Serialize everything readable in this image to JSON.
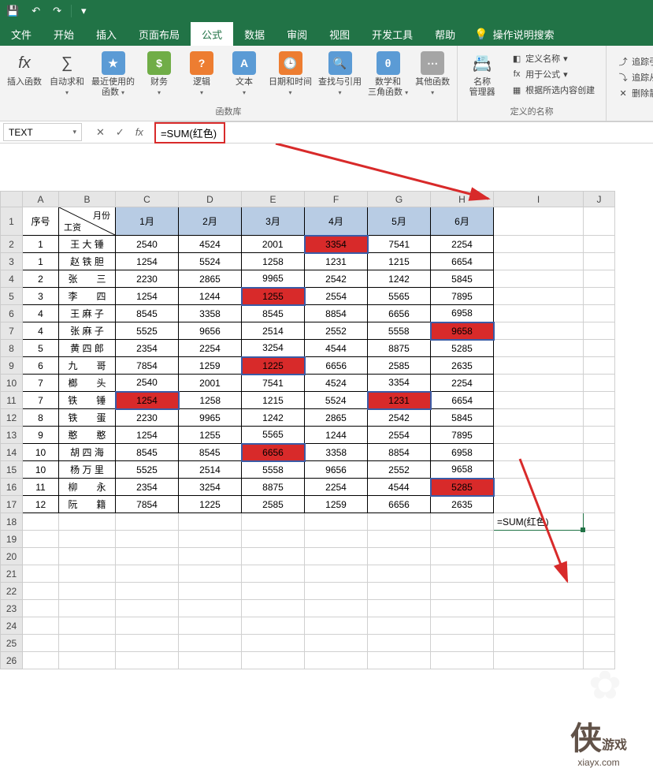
{
  "titlebar": {
    "save_icon": "💾",
    "undo_icon": "↶",
    "redo_icon": "↷"
  },
  "menu": {
    "tabs": [
      "文件",
      "开始",
      "插入",
      "页面布局",
      "公式",
      "数据",
      "审阅",
      "视图",
      "开发工具",
      "帮助"
    ],
    "active_index": 4,
    "search_hint": "操作说明搜索"
  },
  "ribbon": {
    "insert_fn": "插入函数",
    "autosum": "自动求和",
    "recent": "最近使用的\n函数",
    "financial": "财务",
    "logical": "逻辑",
    "text": "文本",
    "datetime": "日期和时间",
    "lookup": "查找与引用",
    "math": "数学和\n三角函数",
    "other": "其他函数",
    "group1_label": "函数库",
    "name_mgr": "名称\n管理器",
    "define_name": "定义名称",
    "use_formula": "用于公式",
    "create_sel": "根据所选内容创建",
    "group2_label": "定义的名称",
    "trace_prec": "追踪引用",
    "trace_dep": "追踪从属",
    "remove_arrows": "删除箭头"
  },
  "formula_bar": {
    "namebox": "TEXT",
    "cancel": "✕",
    "enter": "✓",
    "fx": "fx",
    "formula": "=SUM(红色)"
  },
  "sheet": {
    "col_letters": [
      "A",
      "B",
      "C",
      "D",
      "E",
      "F",
      "G",
      "H",
      "I",
      "J"
    ],
    "header_corner_top": "月份",
    "header_corner_bottom": "工资",
    "header_a": "序号",
    "months": [
      "1月",
      "2月",
      "3月",
      "4月",
      "5月",
      "6月"
    ],
    "rows": [
      {
        "n": "1",
        "name": "王 大 锤",
        "v": [
          "2540",
          "4524",
          "2001",
          "3354",
          "7541",
          "2254"
        ],
        "hl": [
          3
        ]
      },
      {
        "n": "1",
        "name": "赵 铁 胆",
        "v": [
          "1254",
          "5524",
          "1258",
          "1231",
          "1215",
          "6654"
        ],
        "hl": []
      },
      {
        "n": "2",
        "name": "张　　三",
        "v": [
          "2230",
          "2865",
          "9965",
          "2542",
          "1242",
          "5845"
        ],
        "hl": []
      },
      {
        "n": "3",
        "name": "李　　四",
        "v": [
          "1254",
          "1244",
          "1255",
          "2554",
          "5565",
          "7895"
        ],
        "hl": [
          2
        ]
      },
      {
        "n": "4",
        "name": "王 麻 子",
        "v": [
          "8545",
          "3358",
          "8545",
          "8854",
          "6656",
          "6958"
        ],
        "hl": []
      },
      {
        "n": "4",
        "name": "张 麻 子",
        "v": [
          "5525",
          "9656",
          "2514",
          "2552",
          "5558",
          "9658"
        ],
        "hl": [
          5
        ]
      },
      {
        "n": "5",
        "name": "黄 四 郎",
        "v": [
          "2354",
          "2254",
          "3254",
          "4544",
          "8875",
          "5285"
        ],
        "hl": []
      },
      {
        "n": "6",
        "name": "九　　哥",
        "v": [
          "7854",
          "1259",
          "1225",
          "6656",
          "2585",
          "2635"
        ],
        "hl": [
          2
        ]
      },
      {
        "n": "7",
        "name": "榔　　头",
        "v": [
          "2540",
          "2001",
          "7541",
          "4524",
          "3354",
          "2254"
        ],
        "hl": []
      },
      {
        "n": "7",
        "name": "铁　　锤",
        "v": [
          "1254",
          "1258",
          "1215",
          "5524",
          "1231",
          "6654"
        ],
        "hl": [
          0,
          4
        ]
      },
      {
        "n": "8",
        "name": "铁　　蛋",
        "v": [
          "2230",
          "9965",
          "1242",
          "2865",
          "2542",
          "5845"
        ],
        "hl": []
      },
      {
        "n": "9",
        "name": "憨　　憨",
        "v": [
          "1254",
          "1255",
          "5565",
          "1244",
          "2554",
          "7895"
        ],
        "hl": []
      },
      {
        "n": "10",
        "name": "胡 四 海",
        "v": [
          "8545",
          "8545",
          "6656",
          "3358",
          "8854",
          "6958"
        ],
        "hl": [
          2
        ]
      },
      {
        "n": "10",
        "name": "杨 万 里",
        "v": [
          "5525",
          "2514",
          "5558",
          "9656",
          "2552",
          "9658"
        ],
        "hl": []
      },
      {
        "n": "11",
        "name": "柳　　永",
        "v": [
          "2354",
          "3254",
          "8875",
          "2254",
          "4544",
          "5285"
        ],
        "hl": [
          5
        ]
      },
      {
        "n": "12",
        "name": "阮　　籍",
        "v": [
          "7854",
          "1225",
          "2585",
          "1259",
          "6656",
          "2635"
        ],
        "hl": []
      }
    ],
    "formula_cell": "=SUM(红色)",
    "row_numbers": [
      1,
      2,
      3,
      4,
      5,
      6,
      7,
      8,
      9,
      10,
      11,
      12,
      13,
      14,
      15,
      16,
      17,
      18,
      19,
      20,
      21,
      22,
      23,
      24,
      25,
      26
    ]
  },
  "watermark": {
    "logo": "侠",
    "site": "xiayx.com",
    "tag": "游戏"
  }
}
